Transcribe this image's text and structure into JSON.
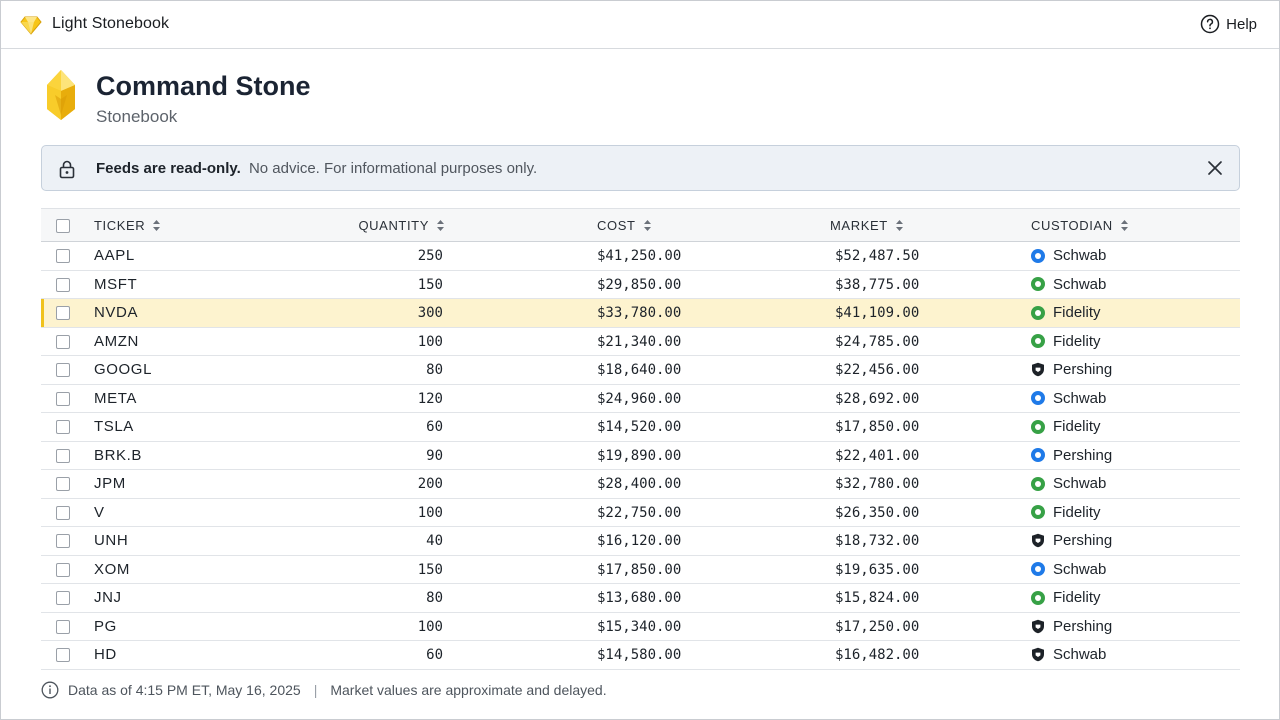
{
  "app": {
    "title": "Light Stonebook",
    "help_label": "Help"
  },
  "page": {
    "title": "Command Stone",
    "subtitle": "Stonebook"
  },
  "notice": {
    "bold": "Feeds are read-only.",
    "text": "No advice. For informational purposes only."
  },
  "table": {
    "headers": {
      "ticker": "TICKER",
      "quantity": "QUANTITY",
      "cost": "COST",
      "market": "MARKET",
      "custodian": "CUSTODIAN"
    },
    "selected_index": 2,
    "rows": [
      {
        "ticker": "AAPL",
        "quantity": "250",
        "cost": "$41,250.00",
        "market": "$52,487.50",
        "custodian": "Schwab",
        "icon": "blue"
      },
      {
        "ticker": "MSFT",
        "quantity": "150",
        "cost": "$29,850.00",
        "market": "$38,775.00",
        "custodian": "Schwab",
        "icon": "green"
      },
      {
        "ticker": "NVDA",
        "quantity": "300",
        "cost": "$33,780.00",
        "market": "$41,109.00",
        "custodian": "Fidelity",
        "icon": "green"
      },
      {
        "ticker": "AMZN",
        "quantity": "100",
        "cost": "$21,340.00",
        "market": "$24,785.00",
        "custodian": "Fidelity",
        "icon": "green"
      },
      {
        "ticker": "GOOGL",
        "quantity": "80",
        "cost": "$18,640.00",
        "market": "$22,456.00",
        "custodian": "Pershing",
        "icon": "shield"
      },
      {
        "ticker": "META",
        "quantity": "120",
        "cost": "$24,960.00",
        "market": "$28,692.00",
        "custodian": "Schwab",
        "icon": "blue"
      },
      {
        "ticker": "TSLA",
        "quantity": "60",
        "cost": "$14,520.00",
        "market": "$17,850.00",
        "custodian": "Fidelity",
        "icon": "green"
      },
      {
        "ticker": "BRK.B",
        "quantity": "90",
        "cost": "$19,890.00",
        "market": "$22,401.00",
        "custodian": "Pershing",
        "icon": "blue"
      },
      {
        "ticker": "JPM",
        "quantity": "200",
        "cost": "$28,400.00",
        "market": "$32,780.00",
        "custodian": "Schwab",
        "icon": "green"
      },
      {
        "ticker": "V",
        "quantity": "100",
        "cost": "$22,750.00",
        "market": "$26,350.00",
        "custodian": "Fidelity",
        "icon": "green"
      },
      {
        "ticker": "UNH",
        "quantity": "40",
        "cost": "$16,120.00",
        "market": "$18,732.00",
        "custodian": "Pershing",
        "icon": "shield"
      },
      {
        "ticker": "XOM",
        "quantity": "150",
        "cost": "$17,850.00",
        "market": "$19,635.00",
        "custodian": "Schwab",
        "icon": "blue"
      },
      {
        "ticker": "JNJ",
        "quantity": "80",
        "cost": "$13,680.00",
        "market": "$15,824.00",
        "custodian": "Fidelity",
        "icon": "green"
      },
      {
        "ticker": "PG",
        "quantity": "100",
        "cost": "$15,340.00",
        "market": "$17,250.00",
        "custodian": "Pershing",
        "icon": "shield"
      },
      {
        "ticker": "HD",
        "quantity": "60",
        "cost": "$14,580.00",
        "market": "$16,482.00",
        "custodian": "Schwab",
        "icon": "shield"
      }
    ]
  },
  "footer": {
    "asof": "Data as of 4:15 PM ET, May 16, 2025",
    "separator": "|",
    "note": "Market values are approximate and delayed."
  },
  "colors": {
    "accent": "#f0c21c",
    "selected_row": "#fdf3cf",
    "schwab_blue": "#1f7ae8",
    "fidelity_green": "#37a146"
  },
  "icons": {
    "logo": "diamond-gem-icon",
    "help": "help-circle-icon",
    "lock": "lock-icon",
    "close": "close-icon",
    "info": "info-icon",
    "sort": "sort-icon"
  }
}
